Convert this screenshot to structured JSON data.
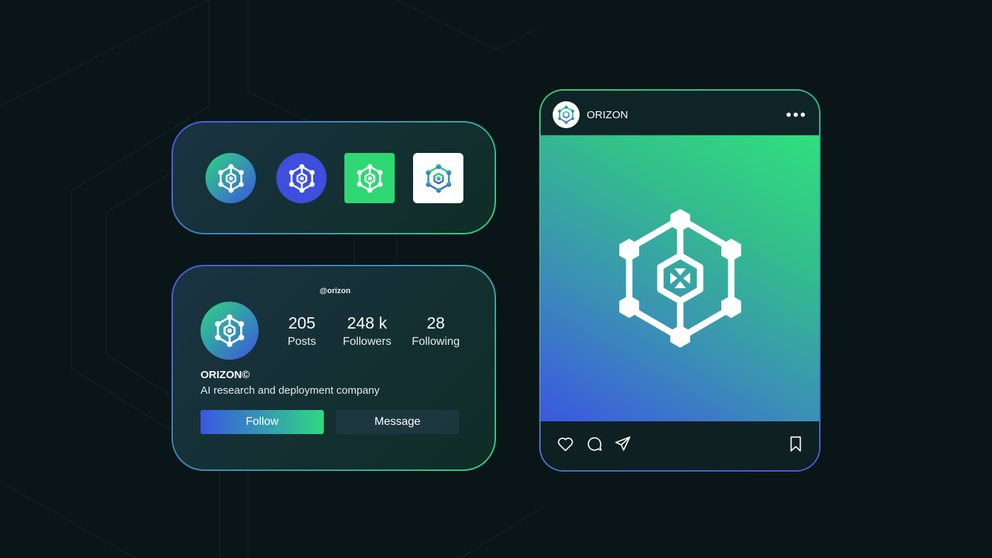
{
  "logos_card": {
    "variants": [
      {
        "name": "gradient-circle",
        "icon_color": "#ffffff"
      },
      {
        "name": "blue-circle",
        "icon_color": "#ffffff"
      },
      {
        "name": "green-square",
        "icon_color": "#ffffff"
      },
      {
        "name": "white-square",
        "icon_color": "gradient"
      }
    ]
  },
  "profile": {
    "handle": "@orizon",
    "avatar_icon": "orizon-logo-icon",
    "stats": [
      {
        "value": "205",
        "label": "Posts"
      },
      {
        "value": "248 k",
        "label": "Followers"
      },
      {
        "value": "28",
        "label": "Following"
      }
    ],
    "name": "ORIZON©",
    "bio": "AI research and deployment company",
    "follow_label": "Follow",
    "message_label": "Message"
  },
  "post": {
    "username": "ORIZON",
    "avatar_icon": "orizon-logo-icon",
    "more_icon": "more-dots-icon",
    "image_icon": "orizon-logo-icon",
    "actions": [
      "heart-icon",
      "comment-icon",
      "send-icon",
      "bookmark-icon"
    ]
  },
  "colors": {
    "background": "#0a1517",
    "accent_green": "#2fd680",
    "accent_blue": "#3b57e2"
  }
}
